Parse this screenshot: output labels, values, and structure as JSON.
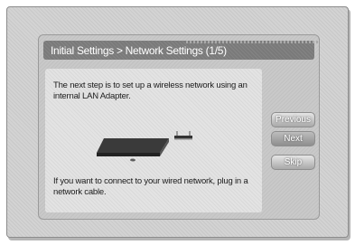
{
  "dialog": {
    "title": "Initial Settings > Network Settings (1/5)",
    "intro_line1": "The next step is to set up a wireless network using an",
    "intro_line2": "internal LAN Adapter.",
    "footer_line1": "If you want to connect to your wired network, plug in a",
    "footer_line2": "network cable."
  },
  "buttons": {
    "previous": "Previous",
    "next": "Next",
    "skip": "Skip"
  },
  "icons": {
    "device": "wireless-lan-adapter-icon"
  }
}
